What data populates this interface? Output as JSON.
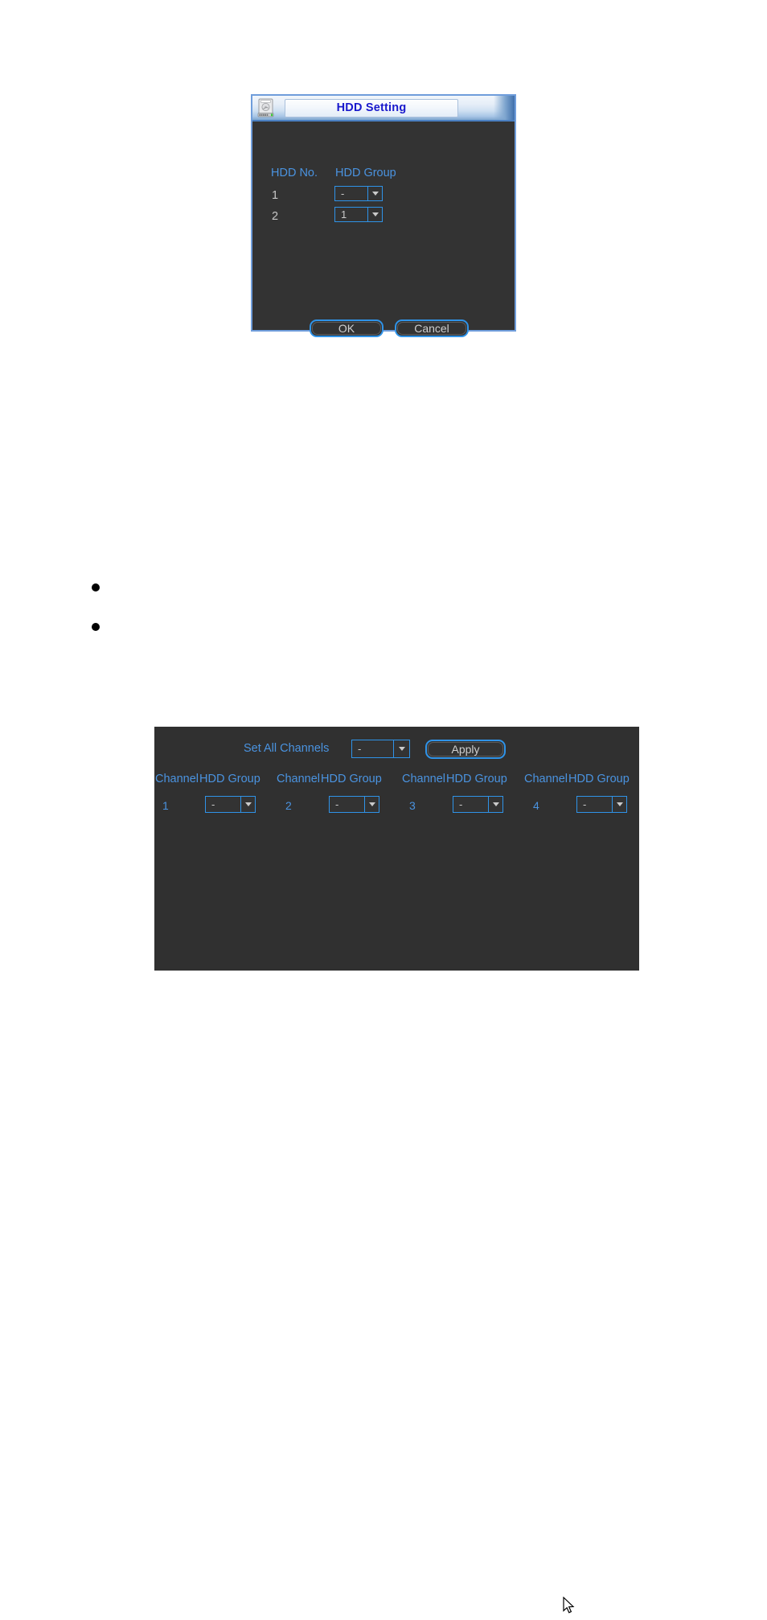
{
  "dialog": {
    "title": "HDD Setting",
    "icon": "hard-disk-icon",
    "columns": {
      "hdd_no": "HDD No.",
      "hdd_group": "HDD Group"
    },
    "rows": [
      {
        "hdd_no": "1",
        "hdd_group": "-"
      },
      {
        "hdd_no": "2",
        "hdd_group": "1"
      }
    ],
    "buttons": {
      "ok": "OK",
      "cancel": "Cancel"
    }
  },
  "panel": {
    "set_all_label": "Set All Channels",
    "set_all_value": "-",
    "apply_label": "Apply",
    "column_headers": {
      "channel": "Channel",
      "hdd_group": "HDD Group"
    },
    "channels": [
      {
        "channel": "1",
        "hdd_group": "-"
      },
      {
        "channel": "2",
        "hdd_group": "-"
      },
      {
        "channel": "3",
        "hdd_group": "-"
      },
      {
        "channel": "4",
        "hdd_group": "-"
      }
    ]
  },
  "bullets": [
    {
      "id": "bullet-1"
    },
    {
      "id": "bullet-2"
    }
  ],
  "cursor": {
    "icon": "arrow-pointer-icon"
  },
  "colors": {
    "accent_blue": "#2f93e8",
    "label_blue": "#4a93e0",
    "title_blue": "#1919cc",
    "panel_bg": "#303030",
    "dialog_bg": "#333333",
    "value_text": "#c9c9c9"
  }
}
